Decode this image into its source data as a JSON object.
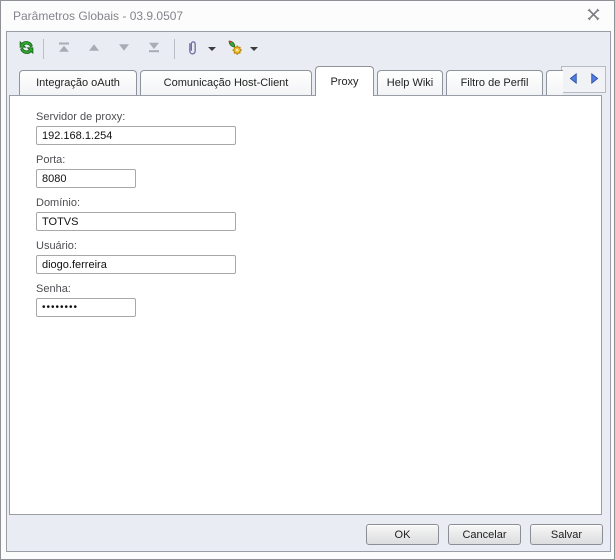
{
  "window": {
    "title": "Parâmetros Globais - 03.9.0507"
  },
  "toolbar": {
    "icons": [
      {
        "name": "refresh-icon",
        "enabled": true
      },
      {
        "name": "first-record-icon",
        "enabled": false
      },
      {
        "name": "previous-record-icon",
        "enabled": false
      },
      {
        "name": "next-record-icon",
        "enabled": false
      },
      {
        "name": "last-record-icon",
        "enabled": false
      },
      {
        "name": "attachment-icon",
        "enabled": true
      },
      {
        "name": "process-icon",
        "enabled": true
      }
    ]
  },
  "tabs": {
    "items": [
      {
        "label": "Integração oAuth",
        "active": false
      },
      {
        "label": "Comunicação Host-Client",
        "active": false
      },
      {
        "label": "Proxy",
        "active": true
      },
      {
        "label": "Help Wiki",
        "active": false
      },
      {
        "label": "Filtro de Perfil",
        "active": false
      }
    ]
  },
  "form": {
    "fields": [
      {
        "label": "Servidor de proxy:",
        "value": "192.168.1.254"
      },
      {
        "label": "Porta:",
        "value": "8080"
      },
      {
        "label": "Domínio:",
        "value": "TOTVS"
      },
      {
        "label": "Usuário:",
        "value": "diogo.ferreira"
      },
      {
        "label": "Senha:",
        "value": "••••••••"
      }
    ]
  },
  "footer": {
    "ok_label": "OK",
    "cancel_label": "Cancelar",
    "save_label": "Salvar"
  },
  "colors": {
    "panel_bg": "#e9edf3",
    "refresh_green": "#2fa832",
    "gear_yellow": "#f2c12e",
    "scroll_arrow_blue": "#4f7ee0",
    "disabled_gray": "#a7adb6",
    "title_text": "#84858b"
  }
}
